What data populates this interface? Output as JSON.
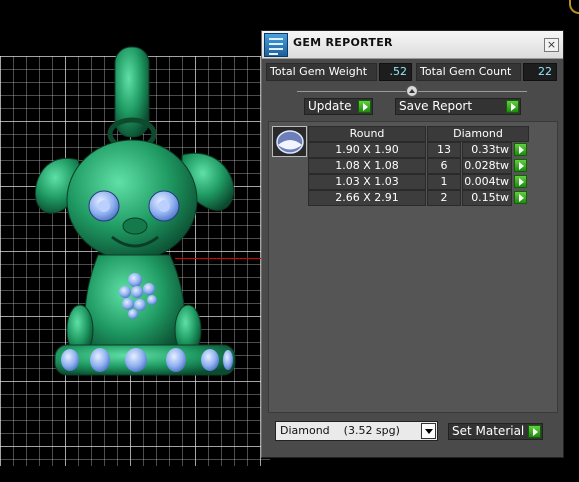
{
  "panel": {
    "title": "GEM REPORTER",
    "close_label": "×",
    "total_weight_label": "Total Gem Weight",
    "total_weight_value": ".52",
    "total_count_label": "Total Gem Count",
    "total_count_value": "22",
    "update_label": "Update",
    "save_report_label": "Save Report",
    "set_material_label": "Set Material"
  },
  "report": {
    "shape_header": "Round",
    "material_header": "Diamond",
    "rows": [
      {
        "size": "1.90 X 1.90",
        "count": "13",
        "tw": "0.33tw"
      },
      {
        "size": "1.08 X 1.08",
        "count": "6",
        "tw": "0.028tw"
      },
      {
        "size": "1.03 X 1.03",
        "count": "1",
        "tw": "0.004tw"
      },
      {
        "size": "2.66 X 2.91",
        "count": "2",
        "tw": "0.15tw"
      }
    ]
  },
  "material_select": {
    "selected": "Diamond    (3.52 spg)"
  },
  "colors": {
    "model_green": "#1f9a63",
    "gem_blue": "#8fb0f0",
    "accent_cyan": "#8fe9ff",
    "go_green": "#3cb024",
    "axis_red": "#dd0000"
  },
  "icons": {
    "app": "gem-reporter-app-icon",
    "close": "close-icon",
    "go": "green-play-arrow-icon",
    "thumb": "round-gem-thumbnail-icon",
    "dropdown": "chevron-down-icon"
  }
}
